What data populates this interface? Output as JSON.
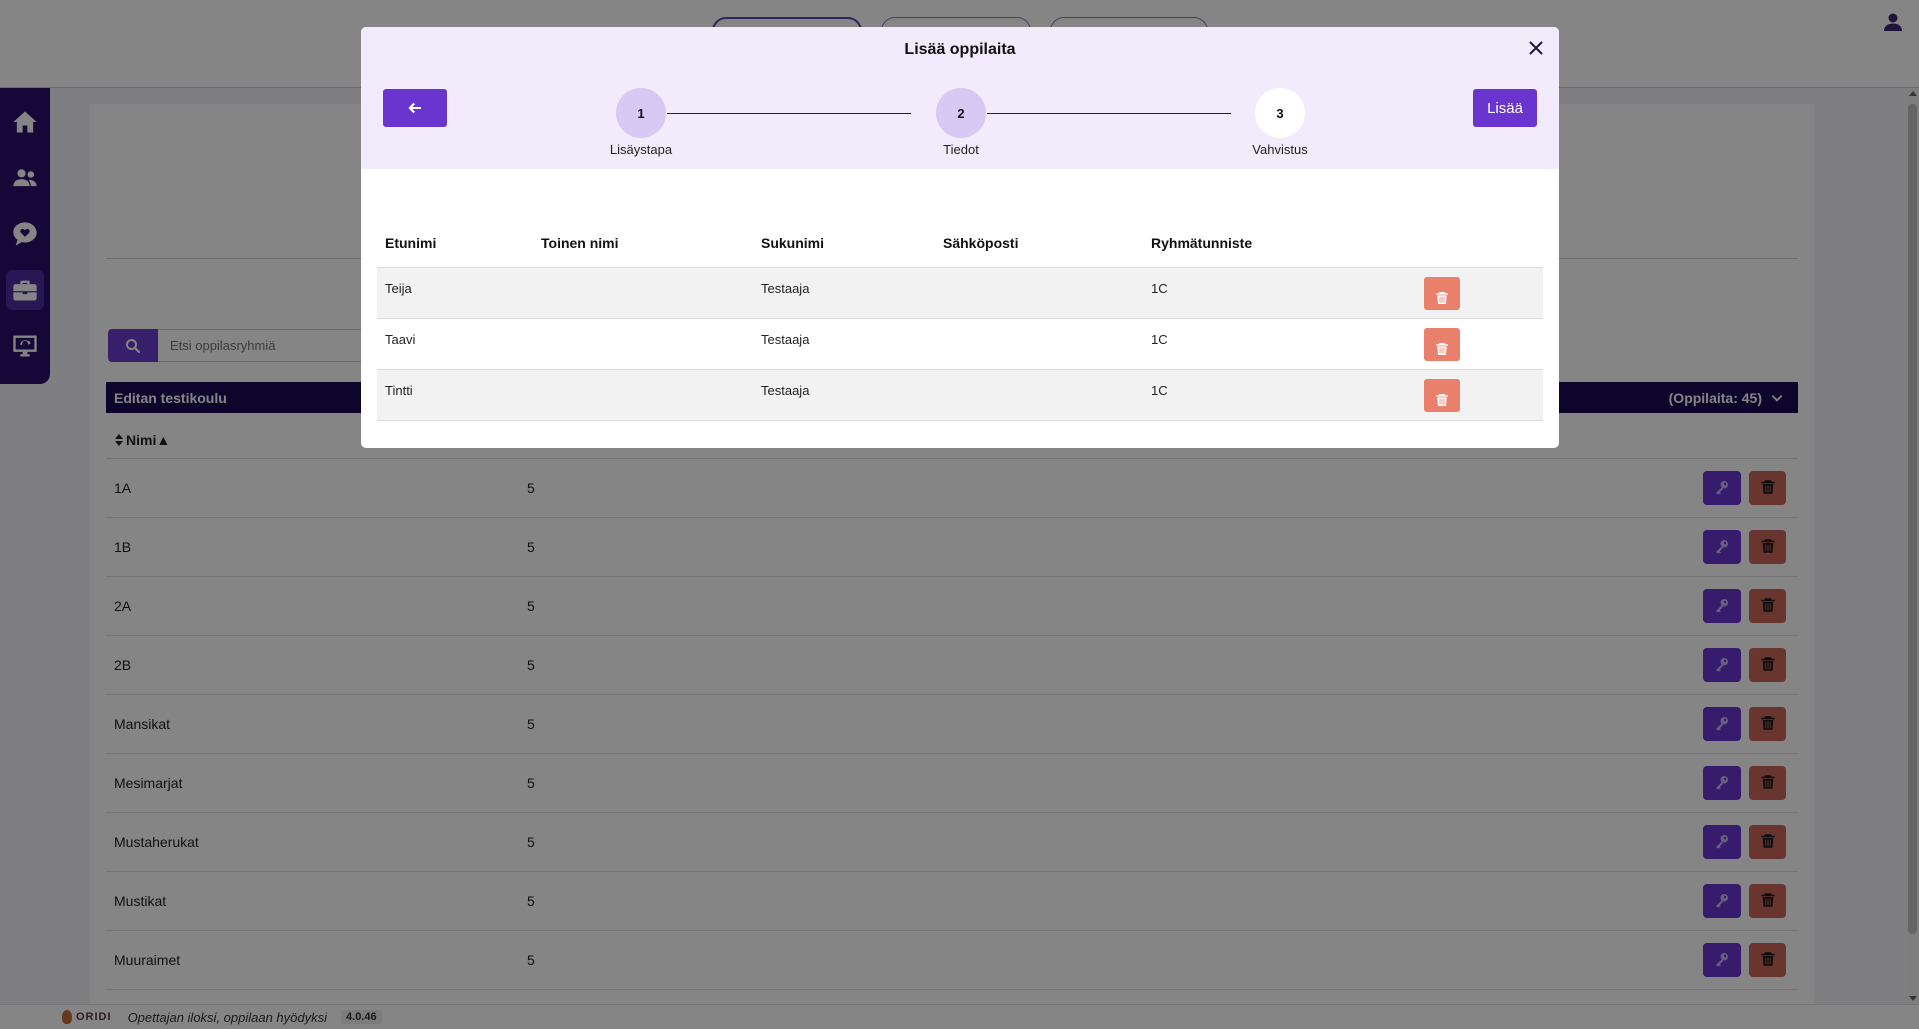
{
  "app": {
    "footer": {
      "logo_text": "ORIDI",
      "tagline": "Opettajan iloksi, oppilaan hyödyksi",
      "version": "4.0.46"
    }
  },
  "sidebar": {
    "items": [
      {
        "icon": "home-icon"
      },
      {
        "icon": "users-icon"
      },
      {
        "icon": "heart-chat-icon"
      },
      {
        "icon": "briefcase-icon",
        "active": true
      },
      {
        "icon": "presentation-icon"
      }
    ]
  },
  "groups_view": {
    "search": {
      "placeholder": "Etsi oppilasryhmiä"
    },
    "school": {
      "name": "Editan testikoulu",
      "count_label": "(Oppilaita: 45)"
    },
    "sort_header": {
      "label": "Nimi▲"
    },
    "rows": [
      {
        "name": "1A",
        "count": "5"
      },
      {
        "name": "1B",
        "count": "5"
      },
      {
        "name": "2A",
        "count": "5"
      },
      {
        "name": "2B",
        "count": "5"
      },
      {
        "name": "Mansikat",
        "count": "5"
      },
      {
        "name": "Mesimarjat",
        "count": "5"
      },
      {
        "name": "Mustaherukat",
        "count": "5"
      },
      {
        "name": "Mustikat",
        "count": "5"
      },
      {
        "name": "Muuraimet",
        "count": "5"
      }
    ]
  },
  "modal": {
    "title": "Lisää oppilaita",
    "add_label": "Lisää",
    "steps": [
      {
        "number": "1",
        "label": "Lisäystapa",
        "state": "done"
      },
      {
        "number": "2",
        "label": "Tiedot",
        "state": "done"
      },
      {
        "number": "3",
        "label": "Vahvistus",
        "state": "current"
      }
    ],
    "table": {
      "headers": {
        "first": "Etunimi",
        "middle": "Toinen nimi",
        "last": "Sukunimi",
        "email": "Sähköposti",
        "group": "Ryhmätunniste"
      },
      "rows": [
        {
          "first": "Teija",
          "middle": "",
          "last": "Testaaja",
          "email": "",
          "group": "1C"
        },
        {
          "first": "Taavi",
          "middle": "",
          "last": "Testaaja",
          "email": "",
          "group": "1C"
        },
        {
          "first": "Tintti",
          "middle": "",
          "last": "Testaaja",
          "email": "",
          "group": "1C"
        }
      ]
    }
  },
  "colors": {
    "primary": "#6a34cf",
    "sidebar": "#2a0f6b",
    "school_bar": "#1a0a55",
    "delete_red": "#e8806c",
    "modal_header": "#f1ebfb"
  }
}
